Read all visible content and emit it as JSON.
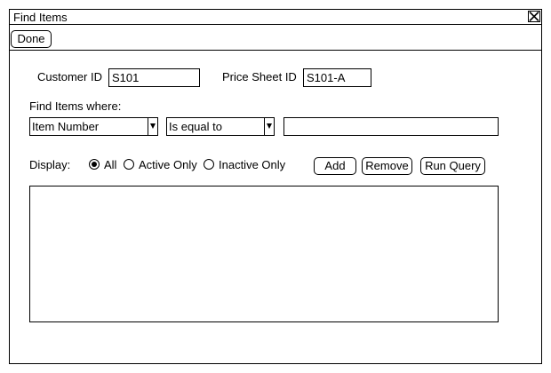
{
  "window": {
    "title": "Find Items"
  },
  "toolbar": {
    "done_label": "Done"
  },
  "form": {
    "customer_id": {
      "label": "Customer ID",
      "value": "S101"
    },
    "price_sheet_id": {
      "label": "Price Sheet ID",
      "value": "S101-A"
    },
    "find_label": "Find Items where:",
    "field_select": {
      "value": "Item Number"
    },
    "operator_select": {
      "value": "Is equal to"
    },
    "criteria_value": "",
    "display": {
      "label": "Display:",
      "options": [
        "All",
        "Active Only",
        "Inactive Only"
      ],
      "selected": "All"
    },
    "buttons": {
      "add": "Add",
      "remove": "Remove",
      "run_query": "Run Query"
    }
  },
  "icons": {
    "close": "close-icon",
    "dropdown": "chevron-down-icon"
  }
}
